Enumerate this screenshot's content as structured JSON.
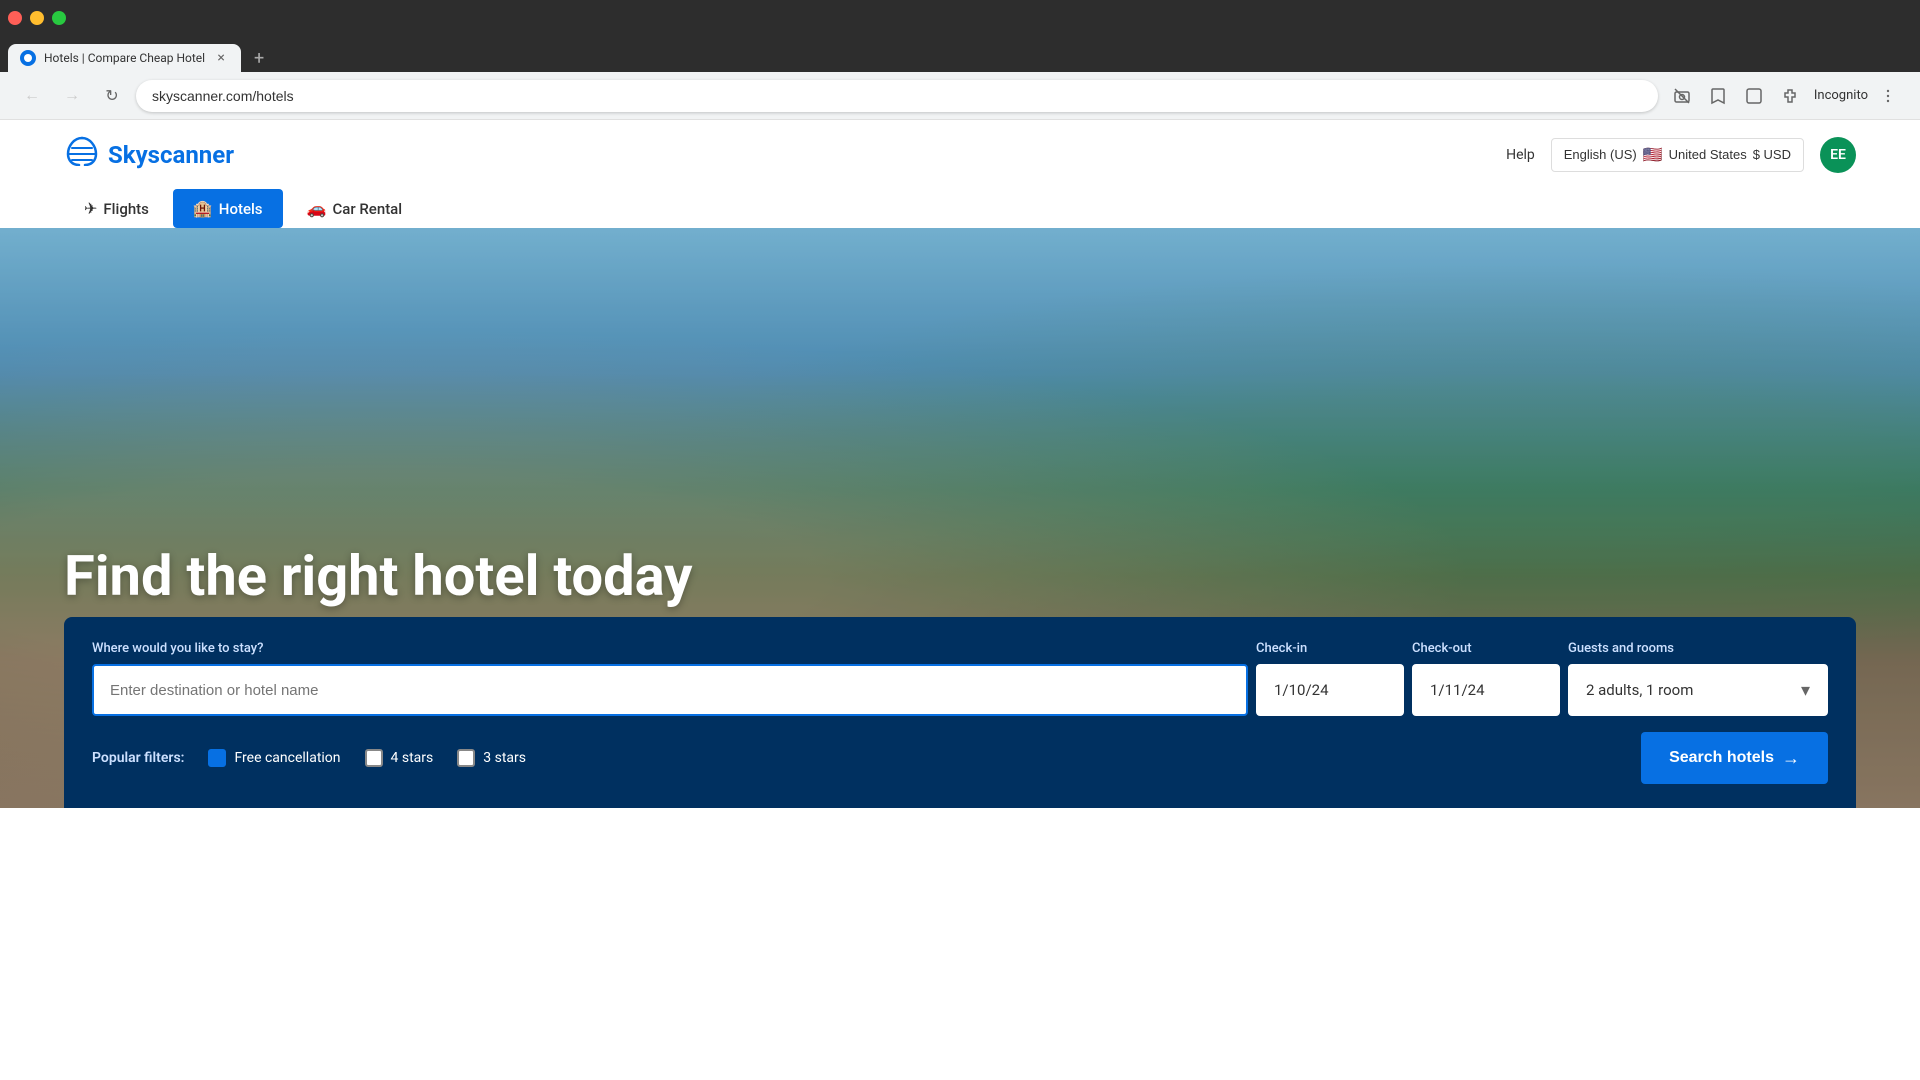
{
  "browser": {
    "tab_title": "Hotels | Compare Cheap Hotel",
    "url": "skyscanner.com/hotels",
    "incognito_label": "Incognito"
  },
  "header": {
    "logo_text": "Skyscanner",
    "help_label": "Help",
    "locale_label": "English (US)",
    "country_label": "United States",
    "currency_label": "$ USD",
    "avatar_initials": "EE"
  },
  "nav": {
    "tabs": [
      {
        "id": "flights",
        "label": "Flights",
        "icon": "✈",
        "active": false
      },
      {
        "id": "hotels",
        "label": "Hotels",
        "icon": "🏨",
        "active": true
      },
      {
        "id": "car-rental",
        "label": "Car Rental",
        "icon": "🚗",
        "active": false
      }
    ]
  },
  "hero": {
    "title": "Find the right hotel today"
  },
  "search": {
    "destination_label": "Where would you like to stay?",
    "destination_placeholder": "Enter destination or hotel name",
    "checkin_label": "Check-in",
    "checkin_value": "1/10/24",
    "checkout_label": "Check-out",
    "checkout_value": "1/11/24",
    "guests_label": "Guests and rooms",
    "guests_value": "2 adults, 1 room",
    "filters_label": "Popular filters:",
    "filters": [
      {
        "id": "free-cancellation",
        "label": "Free cancellation",
        "checked": true
      },
      {
        "id": "4-stars",
        "label": "4 stars",
        "checked": false
      },
      {
        "id": "3-stars",
        "label": "3 stars",
        "checked": false
      }
    ],
    "search_btn_label": "Search hotels"
  }
}
